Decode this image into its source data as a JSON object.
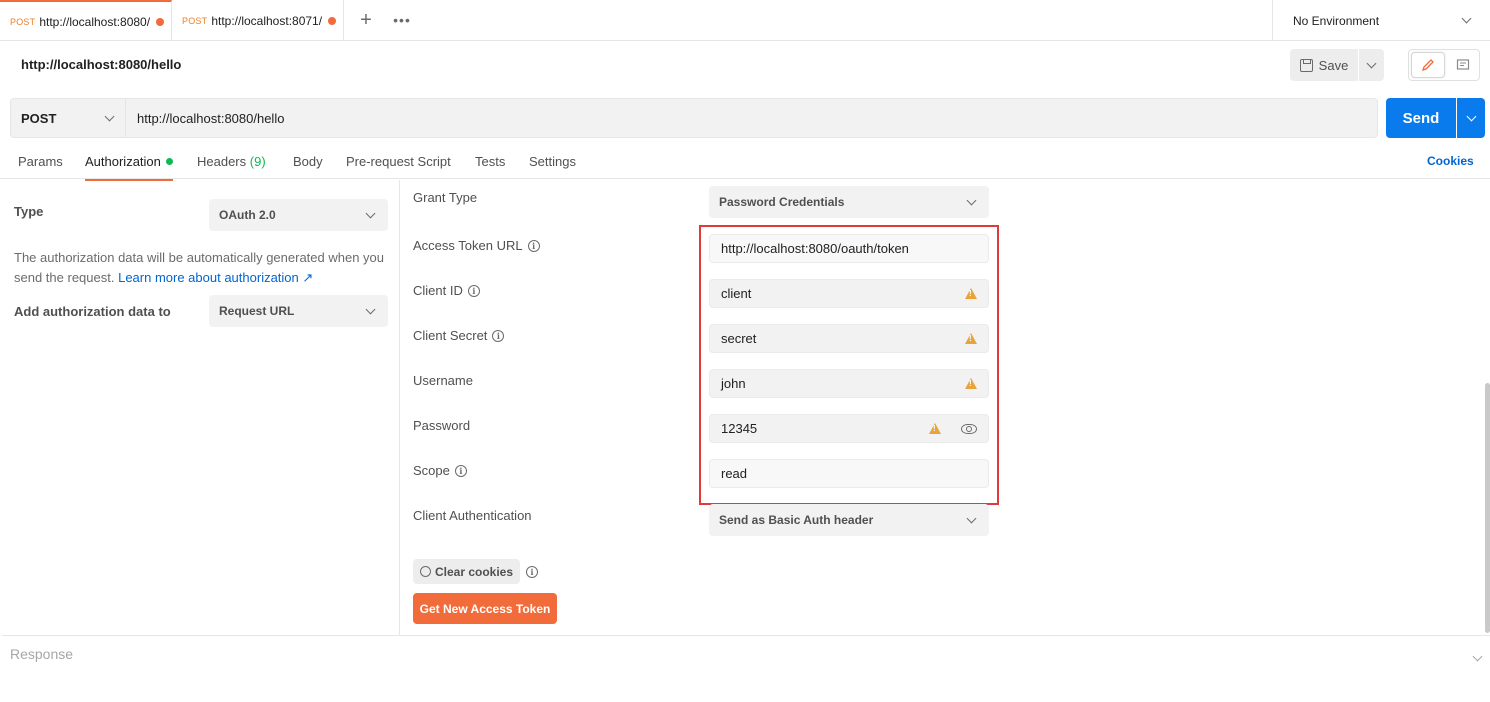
{
  "tabs": [
    {
      "method": "POST",
      "url": "http://localhost:8080/",
      "unsaved": true
    },
    {
      "method": "POST",
      "url": "http://localhost:8071/",
      "unsaved": true
    }
  ],
  "new_tab_icon": "+",
  "more_icon": "ooo",
  "environment": "No Environment",
  "request": {
    "title": "http://localhost:8080/hello",
    "save_label": "Save",
    "method": "POST",
    "url": "http://localhost:8080/hello",
    "send_label": "Send"
  },
  "request_tabs": {
    "params": "Params",
    "authorization": "Authorization",
    "headers": "Headers",
    "headers_count": "(9)",
    "body": "Body",
    "prerequest": "Pre-request Script",
    "tests": "Tests",
    "settings": "Settings",
    "cookies": "Cookies"
  },
  "auth": {
    "type_label": "Type",
    "type_value": "OAuth 2.0",
    "description": "The authorization data will be automatically generated when you send the request.",
    "learn_more": "Learn more about authorization ↗",
    "add_to_label": "Add authorization data to",
    "add_to_value": "Request URL"
  },
  "oauth": {
    "grant_type_label": "Grant Type",
    "grant_type_value": "Password Credentials",
    "access_token_url_label": "Access Token URL",
    "access_token_url": "http://localhost:8080/oauth/token",
    "client_id_label": "Client ID",
    "client_id": "client",
    "client_secret_label": "Client Secret",
    "client_secret": "secret",
    "username_label": "Username",
    "username": "john",
    "password_label": "Password",
    "password": "12345",
    "scope_label": "Scope",
    "scope": "read",
    "client_auth_label": "Client Authentication",
    "client_auth_value": "Send as Basic Auth header",
    "clear_cookies": "Clear cookies",
    "get_token": "Get New Access Token"
  },
  "response": {
    "title": "Response"
  },
  "colors": {
    "accent": "#f26b3a",
    "send": "#097bed",
    "link": "#0265d2",
    "success": "#0cbb52",
    "highlight": "#e03a3a"
  }
}
